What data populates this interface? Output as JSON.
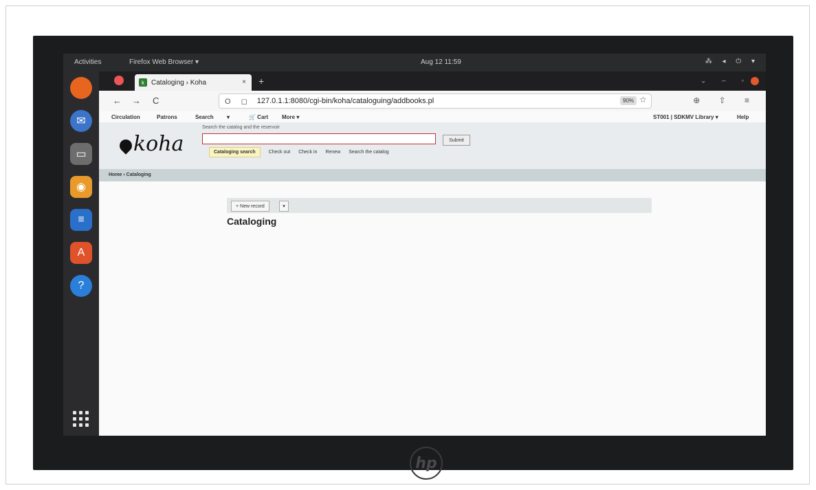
{
  "desktop": {
    "activities": "Activities",
    "app_menu": "Firefox Web Browser ▾",
    "clock": "Aug 12  11:59",
    "tray": "⁂ ◂ ⏻ ▾"
  },
  "browser": {
    "tab_title": "Cataloging › Koha",
    "tab_close": "×",
    "new_tab": "+",
    "back": "←",
    "forward": "→",
    "reload": "C",
    "url_prefix": "O ◻",
    "url": "127.0.1.1:8080/cgi-bin/koha/cataloguing/addbooks.pl",
    "zoom": "90%",
    "star": "☆",
    "right_tools": "⊕ ⇧ ≡",
    "window_controls": "⌄ – ▫"
  },
  "koha": {
    "menu": {
      "circulation": "Circulation",
      "patrons": "Patrons",
      "search": "Search",
      "more_caret": "▾",
      "cart": "🛒 Cart",
      "more": "More ▾"
    },
    "user": "ST001 | SDKMV Library ▾",
    "help": "Help",
    "logo_text": "koha",
    "search_label": "Search the catalog and the reservoir",
    "search_value": "",
    "submit": "Submit",
    "search_tabs": {
      "cataloging_search": "Cataloging search",
      "check_out": "Check out",
      "check_in": "Check in",
      "renew": "Renew",
      "search_catalog": "Search the catalog"
    },
    "breadcrumb": "Home › Cataloging",
    "new_record": "+ New record",
    "new_record_caret": "▾",
    "page_title": "Cataloging"
  }
}
